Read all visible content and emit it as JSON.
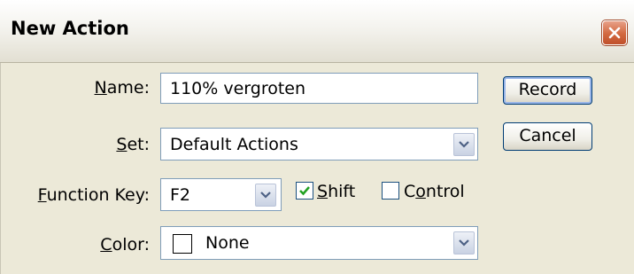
{
  "dialog": {
    "title": "New Action",
    "close_icon": "close-icon"
  },
  "form": {
    "name": {
      "label_acc": "N",
      "label_rest": "ame:",
      "value": "110% vergroten"
    },
    "set": {
      "label_acc": "S",
      "label_rest": "et:",
      "value": "Default Actions"
    },
    "function_key": {
      "label_acc": "F",
      "label_rest": "unction Key:",
      "value": "F2",
      "shift": {
        "label_acc": "S",
        "label_rest": "hift",
        "checked": true
      },
      "control": {
        "label_pre": "C",
        "label_acc": "o",
        "label_rest": "ntrol",
        "checked": false
      }
    },
    "color": {
      "label_acc": "C",
      "label_rest": "olor:",
      "value": "None",
      "swatch": "#ffffff"
    }
  },
  "buttons": {
    "record": "Record",
    "cancel": "Cancel"
  }
}
